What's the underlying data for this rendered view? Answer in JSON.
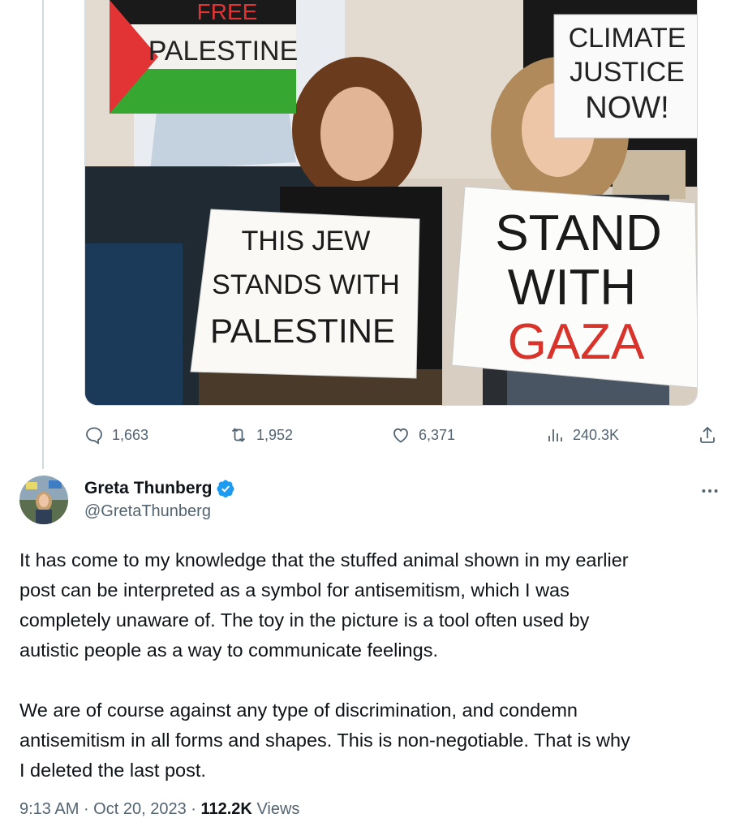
{
  "media": {
    "signs": {
      "free_palestine_top": "FREE",
      "free_palestine_bottom": "PALESTINE",
      "climate": [
        "CLIMATE",
        "JUSTICE",
        "NOW!"
      ],
      "jew": [
        "THIS JEW",
        "STANDS WITH",
        "PALESTINE"
      ],
      "stand": [
        "STAND",
        "WITH",
        "GAZA"
      ]
    }
  },
  "actions": {
    "replies": "1,663",
    "retweets": "1,952",
    "likes": "6,371",
    "views": "240.3K"
  },
  "tweet": {
    "author_name": "Greta Thunberg",
    "handle": "@GretaThunberg",
    "text": "It has come to my knowledge that the stuffed animal shown in my earlier\npost can be interpreted as a symbol for antisemitism, which I was\ncompletely unaware of. The toy in the picture is a tool often used by\nautistic people as a way to communicate feelings.\n\nWe are of course against any type of discrimination, and condemn\nantisemitism in all forms and shapes. This is non-negotiable. That is why\nI deleted the last post.",
    "time": "9:13 AM",
    "date": "Oct 20, 2023",
    "views_count": "112.2K",
    "views_label": "Views"
  },
  "colors": {
    "verified": "#1d9bf0",
    "secondary_text": "#536471",
    "primary_text": "#0f1419",
    "thread_line": "#cfd9de"
  },
  "icons": [
    "reply-icon",
    "retweet-icon",
    "like-icon",
    "views-icon",
    "share-icon",
    "verified-icon",
    "more-icon"
  ]
}
